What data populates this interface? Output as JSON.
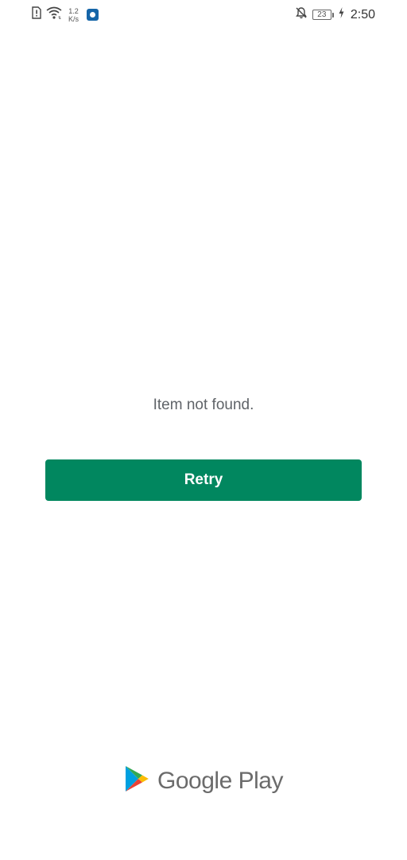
{
  "status_bar": {
    "net_speed_value": "1.2",
    "net_speed_unit": "K/s",
    "battery_level": "23",
    "time": "2:50",
    "icons": [
      "sim-alert-icon",
      "wifi-icon",
      "app-notification-icon",
      "do-not-disturb-icon",
      "battery-icon",
      "charging-icon"
    ]
  },
  "main": {
    "message": "Item not found.",
    "retry_label": "Retry"
  },
  "footer": {
    "brand_name": "Google Play"
  },
  "colors": {
    "accent": "#01875f",
    "message_text": "#5f6368",
    "brand_text": "#6b6b6b"
  }
}
